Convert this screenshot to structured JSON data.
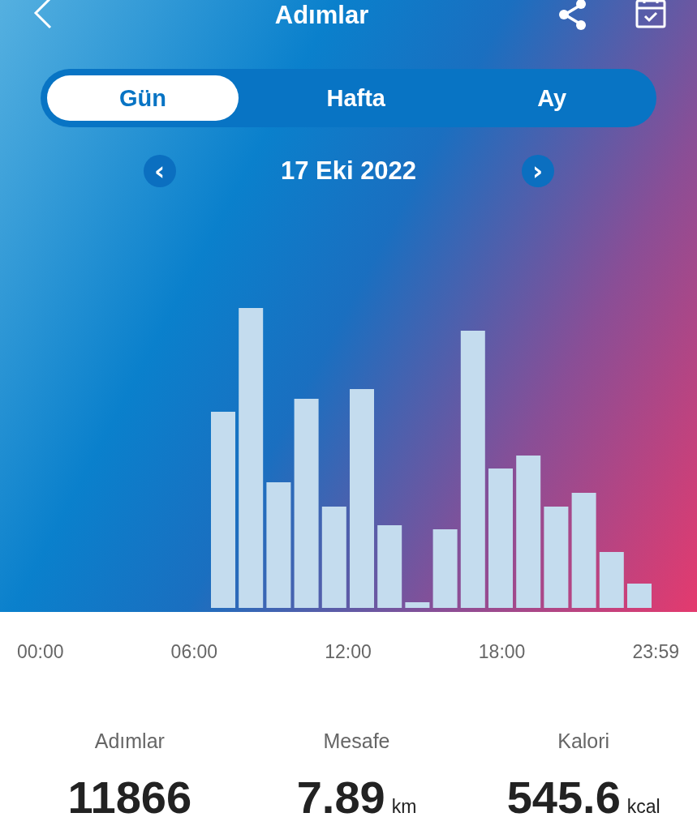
{
  "header": {
    "title": "Adımlar"
  },
  "tabs": [
    {
      "label": "Gün",
      "selected": true
    },
    {
      "label": "Hafta",
      "selected": false
    },
    {
      "label": "Ay",
      "selected": false
    }
  ],
  "date_nav": {
    "prev": "‹",
    "date": "17 Eki 2022",
    "next": "›"
  },
  "x_labels": [
    "00:00",
    "06:00",
    "12:00",
    "18:00",
    "23:59"
  ],
  "stats": [
    {
      "label": "Adımlar",
      "value": "11866"
    },
    {
      "label": "Mesafe",
      "value": "7.89",
      "unit": "km"
    },
    {
      "label": "Kalori",
      "value": "545.6",
      "unit": "kcal"
    }
  ]
}
